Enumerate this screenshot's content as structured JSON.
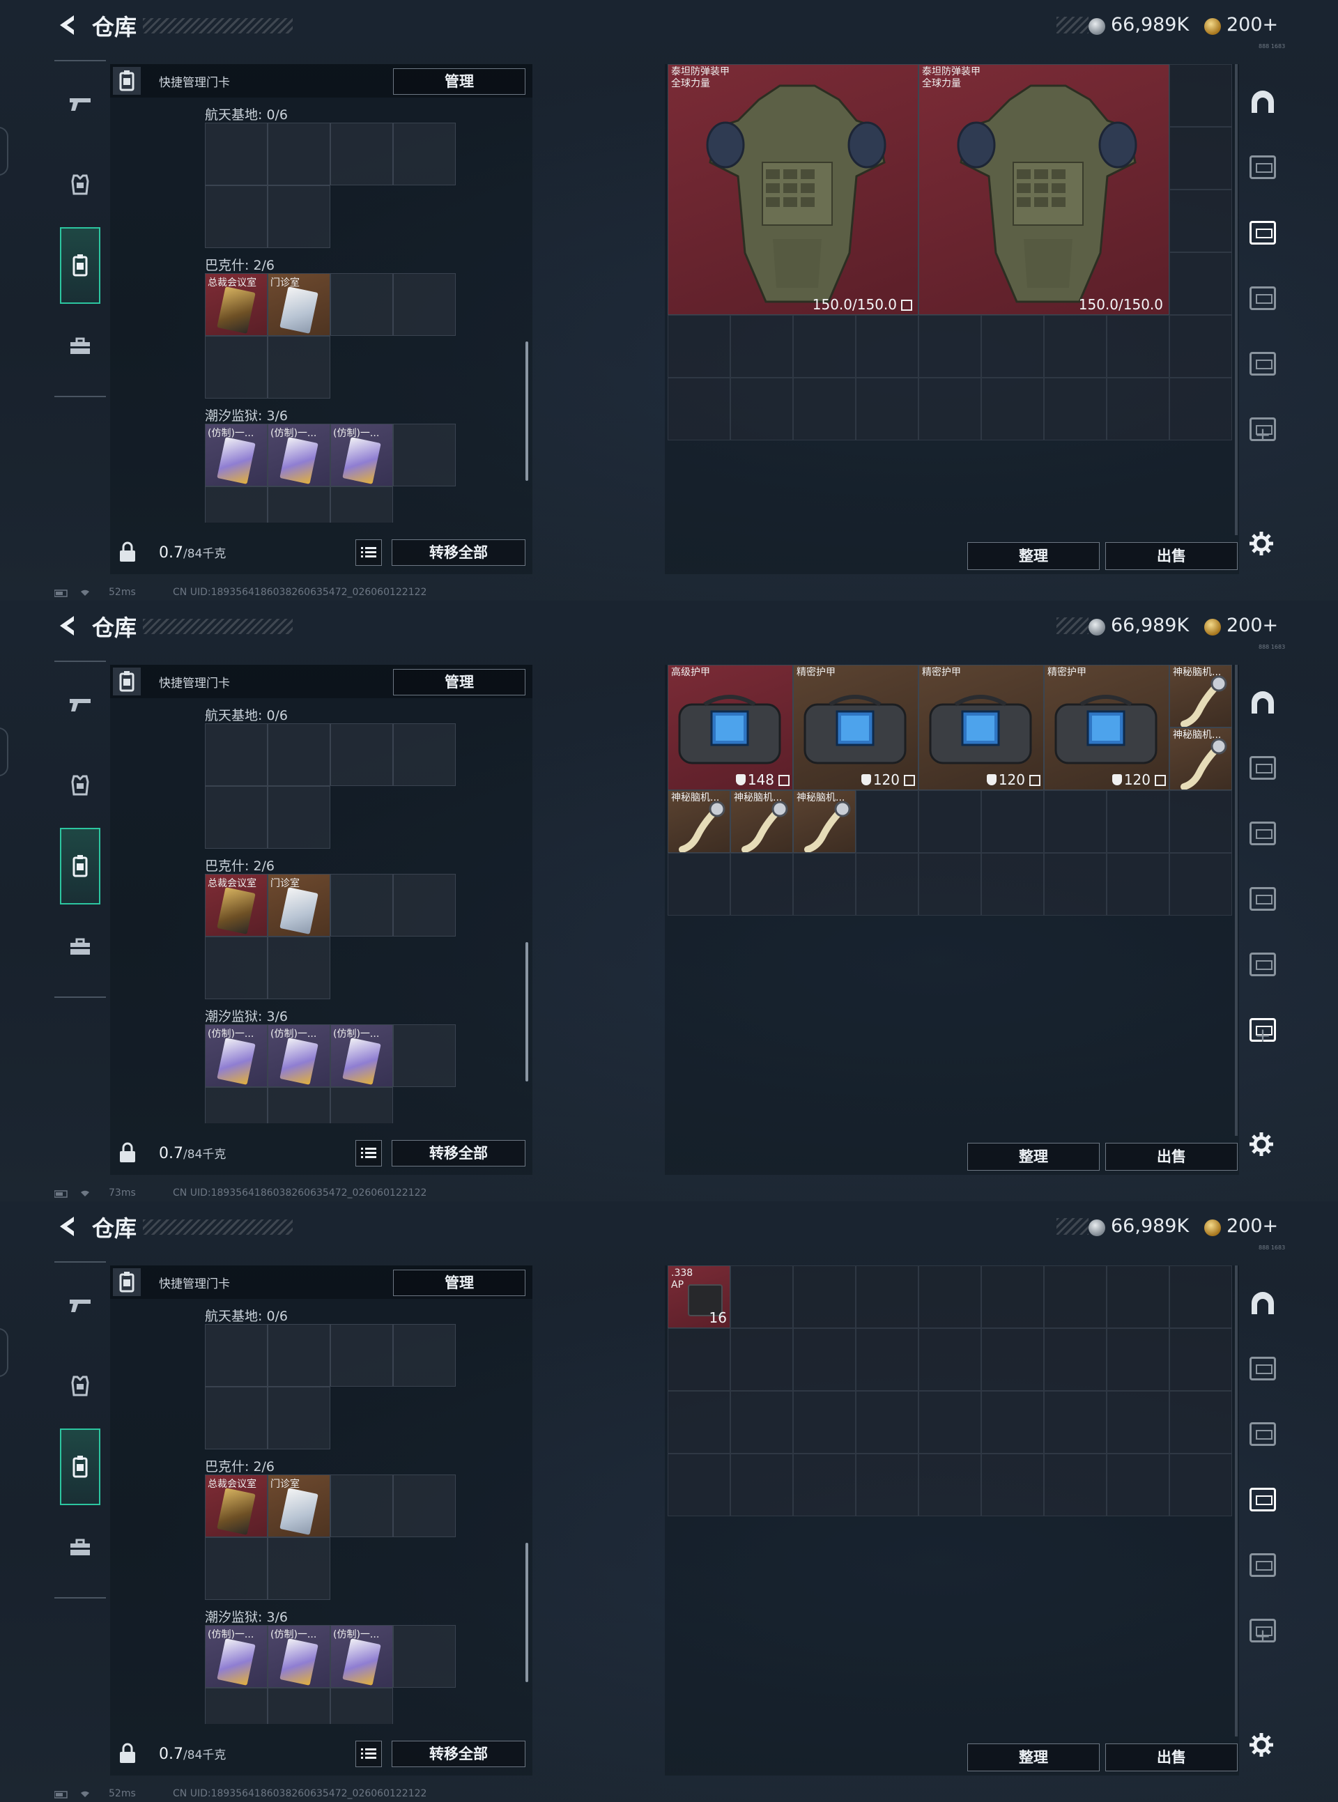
{
  "app": {
    "title": "仓库",
    "currency_silver": "66,989K",
    "currency_gold": "200+",
    "currency_sub": "888 1683"
  },
  "left_panel": {
    "cardbar_label": "快捷管理门卡",
    "manage_label": "管理",
    "weight_value": "0.7",
    "weight_cap": "/84千克",
    "transfer_label": "转移全部",
    "groups": [
      {
        "label": "航天基地: 0/6"
      },
      {
        "label": "巴克什: 2/6"
      },
      {
        "label": "潮汐监狱: 3/6"
      }
    ],
    "bakshi_items": [
      "总裁会议室",
      "门诊室"
    ],
    "tide_items": [
      "(仿制)一...",
      "(仿制)一...",
      "(仿制)一..."
    ]
  },
  "right_panel": {
    "sort_label": "整理",
    "sell_label": "出售",
    "add_tab": "+"
  },
  "screens": [
    {
      "ping": "52ms",
      "uid": "CN UID:1893564186038260635472_026060122122",
      "active_tab": 2,
      "items": [
        {
          "name1": "泰坦防弹装甲",
          "name2": "全球力量",
          "value": "150.0/150.0"
        },
        {
          "name1": "泰坦防弹装甲",
          "name2": "全球力量",
          "value": "150.0/150.0"
        }
      ]
    },
    {
      "ping": "73ms",
      "uid": "CN UID:1893564186038260635472_026060122122",
      "active_tab": 5,
      "items": [
        {
          "name": "高级护甲",
          "value": "148"
        },
        {
          "name": "精密护甲",
          "value": "120"
        },
        {
          "name": "精密护甲",
          "value": "120"
        },
        {
          "name": "精密护甲",
          "value": "120"
        },
        {
          "name": "神秘脑机..."
        },
        {
          "name": "神秘脑机..."
        },
        {
          "name": "神秘脑机..."
        },
        {
          "name": "神秘脑机..."
        },
        {
          "name": "神秘脑机..."
        }
      ]
    },
    {
      "ping": "52ms",
      "uid": "CN UID:1893564186038260635472_026060122122",
      "active_tab": 3,
      "items": [
        {
          "name1": ".338",
          "name2": "AP",
          "value": "16"
        }
      ]
    }
  ],
  "colors": {
    "accent": "#2cc6a0",
    "red_rarity": "#7a2b36",
    "orange_rarity": "#5b4331",
    "purple_rarity": "#4d4669"
  }
}
